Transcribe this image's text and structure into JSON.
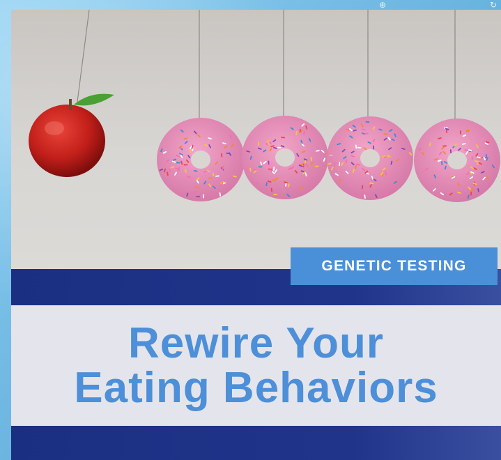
{
  "post": {
    "tag": "GENETIC TESTING",
    "title_line_1": "Rewire Your",
    "title_line_2": "Eating Behaviors"
  },
  "photo": {
    "objects": [
      "apple",
      "donut",
      "donut",
      "donut",
      "donut"
    ]
  },
  "colors": {
    "navy_band": "#1b2f82",
    "tag_blue": "#4a90d9",
    "title_blue": "#4d8fd8",
    "title_panel": "#e4e5ec"
  }
}
